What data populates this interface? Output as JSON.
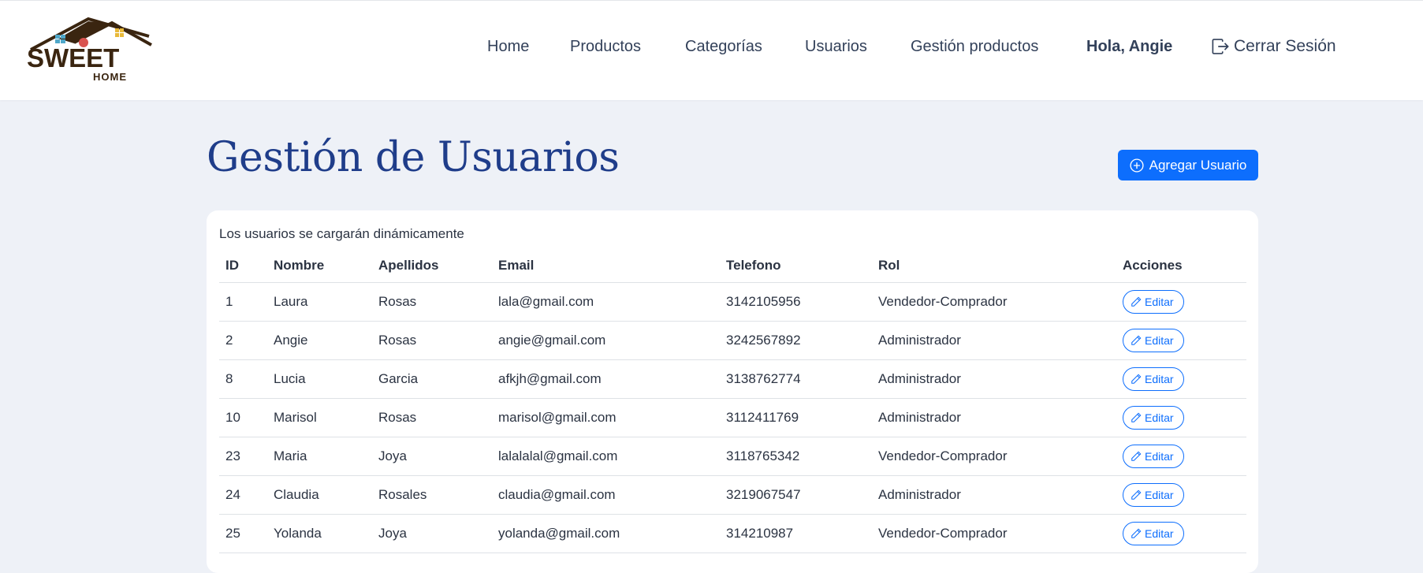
{
  "brand": {
    "line1": "SWEET",
    "line2": "HOME"
  },
  "nav": {
    "home": "Home",
    "productos": "Productos",
    "categorias": "Categorías",
    "usuarios": "Usuarios",
    "gestion_productos": "Gestión productos",
    "greeting": "Hola, Angie",
    "logout": "Cerrar Sesión"
  },
  "page": {
    "title": "Gestión de Usuarios",
    "add_button": "Agregar Usuario",
    "note": "Los usuarios se cargarán dinámicamente"
  },
  "table": {
    "headers": {
      "id": "ID",
      "nombre": "Nombre",
      "apellidos": "Apellidos",
      "email": "Email",
      "telefono": "Telefono",
      "rol": "Rol",
      "acciones": "Acciones"
    },
    "edit_label": "Editar",
    "rows": [
      {
        "id": "1",
        "nombre": "Laura",
        "apellidos": "Rosas",
        "email": "lala@gmail.com",
        "telefono": "3142105956",
        "rol": "Vendedor-Comprador"
      },
      {
        "id": "2",
        "nombre": "Angie",
        "apellidos": "Rosas",
        "email": "angie@gmail.com",
        "telefono": "3242567892",
        "rol": "Administrador"
      },
      {
        "id": "8",
        "nombre": "Lucia",
        "apellidos": "Garcia",
        "email": "afkjh@gmail.com",
        "telefono": "3138762774",
        "rol": "Administrador"
      },
      {
        "id": "10",
        "nombre": "Marisol",
        "apellidos": "Rosas",
        "email": "marisol@gmail.com",
        "telefono": "3112411769",
        "rol": "Administrador"
      },
      {
        "id": "23",
        "nombre": "Maria",
        "apellidos": "Joya",
        "email": "lalalalal@gmail.com",
        "telefono": "3118765342",
        "rol": "Vendedor-Comprador"
      },
      {
        "id": "24",
        "nombre": "Claudia",
        "apellidos": "Rosales",
        "email": "claudia@gmail.com",
        "telefono": "3219067547",
        "rol": "Administrador"
      },
      {
        "id": "25",
        "nombre": "Yolanda",
        "apellidos": "Joya",
        "email": "yolanda@gmail.com",
        "telefono": "314210987",
        "rol": "Vendedor-Comprador"
      }
    ]
  },
  "colors": {
    "primary": "#0d6efd",
    "title": "#1f3d8a",
    "background": "#eef1f7",
    "brand": "#3a2510"
  },
  "icons": {
    "add": "plus-circle-icon",
    "edit": "pencil-icon",
    "logout": "box-arrow-right-icon"
  }
}
